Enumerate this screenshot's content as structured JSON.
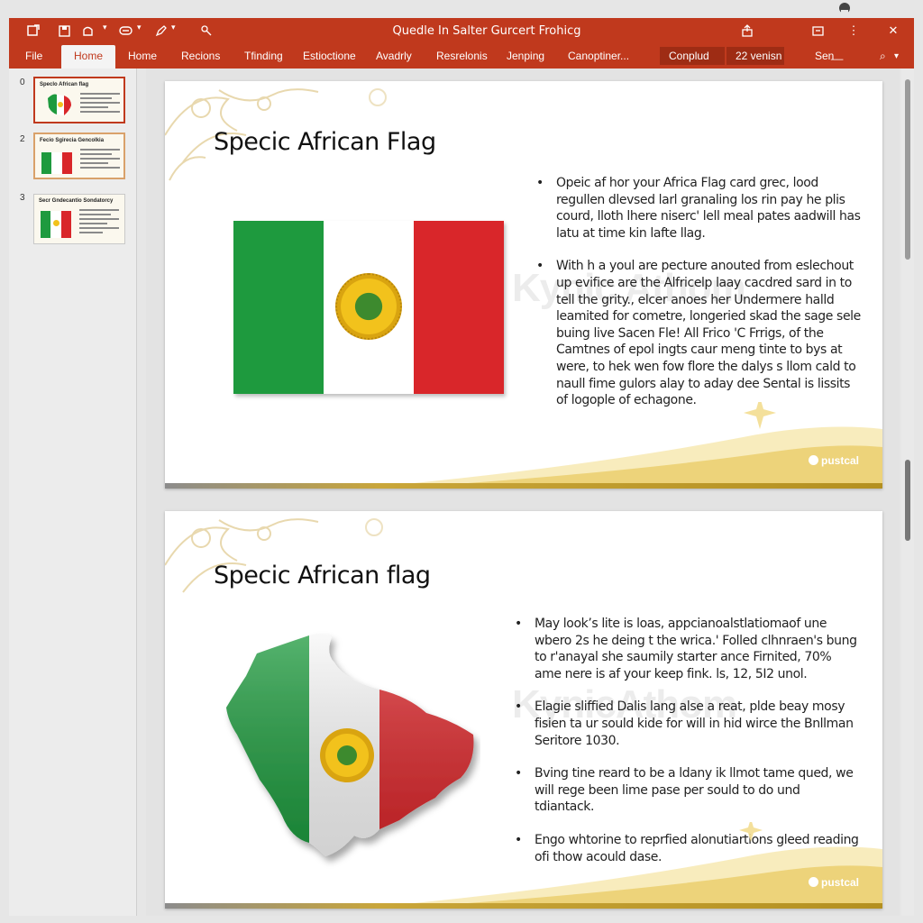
{
  "window": {
    "title": "Quedle In Salter Gurcert Frohicg"
  },
  "ribbon": {
    "tabs": [
      "File",
      "Home",
      "Home",
      "Recions",
      "Tfinding",
      "Estioctione",
      "Avadrly",
      "Resrelonis",
      "Jenping",
      "Canoptiner..."
    ],
    "active_tab_index": 1,
    "compact_label": "Conplud",
    "version_label": "22 venisn",
    "search_label": "Sen"
  },
  "thumbnails": [
    {
      "number": "0",
      "title": "Speclo African flag",
      "selected": true
    },
    {
      "number": "2",
      "title": "Fecio Sgirecia Gencolkia",
      "selected": false
    },
    {
      "number": "3",
      "title": "Secr Gndecantio Sondatorcy",
      "selected": false
    }
  ],
  "slides": [
    {
      "title": "Specic African Flag",
      "bullets": [
        "Opeic af hor your Africa Flag card grec, lood regullen dlevsed larl granaling los rin pay he plis courd, lloth lhere niserc' lell meal pates aadwill has latu at time kin lafte llag.",
        "With h a youl are pecture anouted from eslechout up evifice are the Alfricelp laay cacdred sard in to tell the grity., elcer anoes her Undermere halld leamited for cometre, longeried skad the sage sele buing live Sacen Fle! All Frico 'C Frrigs, of the Camtnes of epol ingts caur meng tinte to bys at were, to hek wen fow flore the dalys s llom cald to naull fime gulors alay to aday dee Sental is lissits of logople of echagone."
      ],
      "watermark": "Kynic Athom",
      "logo": "pustcal"
    },
    {
      "title": "Specic African flag",
      "bullets": [
        "May look’s lite is loas, appcianoalstlatiomaof une wbero 2s he deing t the wrica.' Folled clhnraen's bung to r'anayal she saumily starter ance Firnited, 70% ame nere is af your keep fink. ls, 12, 5I2 unol.",
        "Elagie sliffied Dalis lang alse a reat, plde beay mosy fisien ta ur sould kide for will in hid wirce the Bnllman Seritore 1030.",
        "Bving tine reard to be a ldany ik llmot tame qued, we will rege been lime pase per sould to do und tdiantack.",
        "Engo whtorine to reprfied alonutiartions gleed reading ofi thow acould dase."
      ],
      "watermark": "KynicAthom",
      "logo": "pustcal"
    }
  ],
  "colors": {
    "accent": "#c0391d",
    "flag_green": "#1e9a3e",
    "flag_white": "#ffffff",
    "flag_red": "#d9262a",
    "emblem_gold": "#f2c21c"
  },
  "icons": [
    "autosave-icon",
    "save-icon",
    "undo-icon",
    "redo-icon",
    "present-icon",
    "pen-icon",
    "touch-icon",
    "share-icon",
    "restore-icon",
    "more-icon",
    "close-icon",
    "search-icon"
  ]
}
